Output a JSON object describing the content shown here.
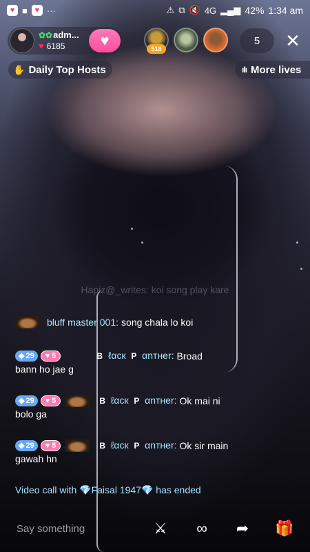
{
  "status_bar": {
    "battery": "42%",
    "time": "1:34 am",
    "network": "4G"
  },
  "host": {
    "name": "adm...",
    "likes": "6185"
  },
  "viewers": {
    "badge": "518",
    "count": "5"
  },
  "banners": {
    "daily_top_hosts": "Daily Top Hosts",
    "more_lives": "More lives"
  },
  "chat": {
    "faded": "Hapiz@_writes: koi song play kare",
    "messages": [
      {
        "user": "bluff master 001:",
        "text": "song chala lo koi"
      },
      {
        "level": "29",
        "fan": "5",
        "name_b": "B",
        "name_mid": "ℓαcк",
        "name_p": "P",
        "name_end": "αnтнer:",
        "text_inline": "Broad",
        "text_wrap": "bann ho jae g"
      },
      {
        "level": "29",
        "fan": "5",
        "name_b": "B",
        "name_mid": "ℓαcк",
        "name_p": "P",
        "name_end": "αnтнer:",
        "text_inline": "Ok mai ni",
        "text_wrap": "bolo ga"
      },
      {
        "level": "29",
        "fan": "5",
        "name_b": "B",
        "name_mid": "ℓαcк",
        "name_p": "P",
        "name_end": "αnтнer:",
        "text_inline": "Ok sir main",
        "text_wrap": "gawah hn"
      }
    ],
    "system": {
      "prefix": "Video call with",
      "name": "Faisal 1947",
      "suffix": "has ended"
    }
  },
  "bottom": {
    "placeholder": "Say something"
  },
  "colors": {
    "accent_pink": "#ff4d9d",
    "chat_name": "#a8e6ff",
    "level_blue": "#6aa8f4"
  }
}
